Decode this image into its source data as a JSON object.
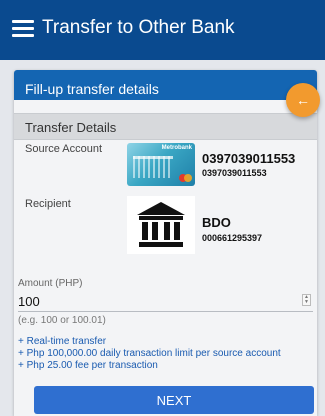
{
  "appbar": {
    "title": "Transfer to Other Bank",
    "menu_icon": "hamburger-menu-icon"
  },
  "card": {
    "header_title": "Fill-up transfer details",
    "back_icon": "arrow-left-icon",
    "section_title": "Transfer Details"
  },
  "source": {
    "label": "Source Account",
    "card_brand": "Metrobank",
    "account_number": "0397039011553",
    "account_number_sub": "0397039011553"
  },
  "recipient": {
    "label": "Recipient",
    "bank_icon": "bank-building-icon",
    "bank_name": "BDO",
    "account_number": "000661295397"
  },
  "amount": {
    "label": "Amount (PHP)",
    "value": "100",
    "hint": "(e.g. 100 or 100.01)"
  },
  "info": [
    "+ Real-time transfer",
    "+ Php 100,000.00 daily transaction limit per source account",
    "+ Php 25.00 fee per transaction"
  ],
  "actions": {
    "next_label": "NEXT"
  },
  "colors": {
    "appbar": "#0a4a8f",
    "card_header": "#1465b2",
    "fab": "#f29a2e",
    "info_text": "#1a5bb0",
    "next_button": "#2f6fd0"
  }
}
